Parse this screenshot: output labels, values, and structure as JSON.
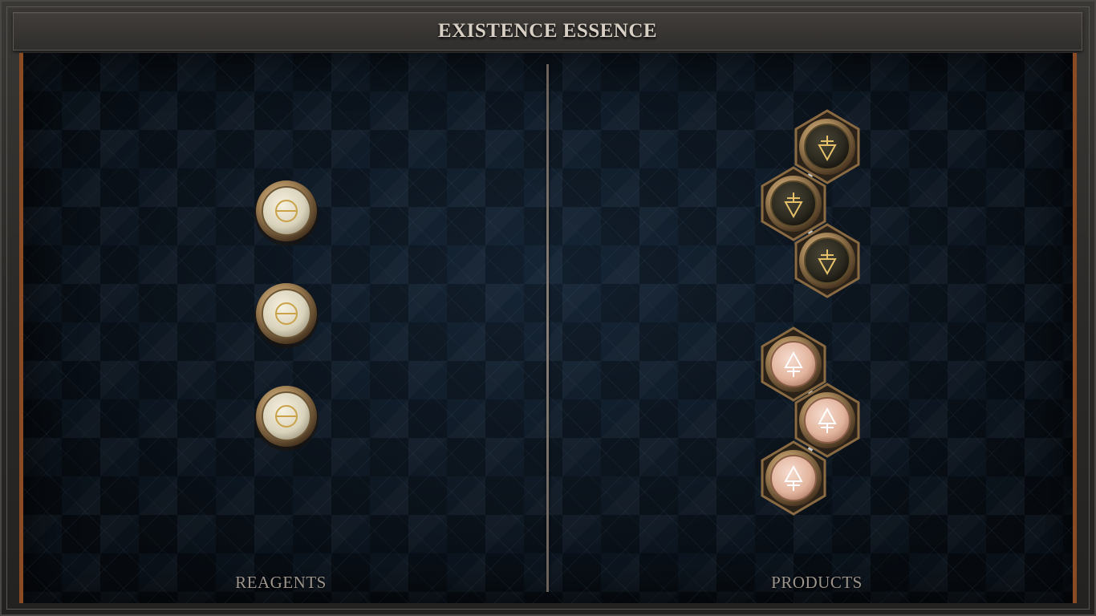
{
  "title": "EXISTENCE ESSENCE",
  "panels": {
    "reagents_label": "REAGENTS",
    "products_label": "PRODUCTS"
  },
  "reagents": [
    {
      "symbol": "salt-theta",
      "glyph": "ϴ",
      "color": "#ece6d2"
    },
    {
      "symbol": "salt-theta",
      "glyph": "ϴ",
      "color": "#ece6d2"
    },
    {
      "symbol": "salt-theta",
      "glyph": "ϴ",
      "color": "#ece6d2"
    }
  ],
  "products": [
    {
      "name": "molecule-dark",
      "element": "earth-symbol",
      "color": "#2e2b22",
      "glyph_color": "#e5c26a",
      "atoms": 3
    },
    {
      "name": "molecule-light",
      "element": "fire-symbol",
      "color": "#e6b9a3",
      "glyph_color": "#fff4ec",
      "atoms": 3
    }
  ],
  "colors": {
    "accent_frame": "#8a4a24",
    "title_text": "#d8cfc4",
    "label_text": "#9c958d",
    "brass": "#a8875a"
  }
}
